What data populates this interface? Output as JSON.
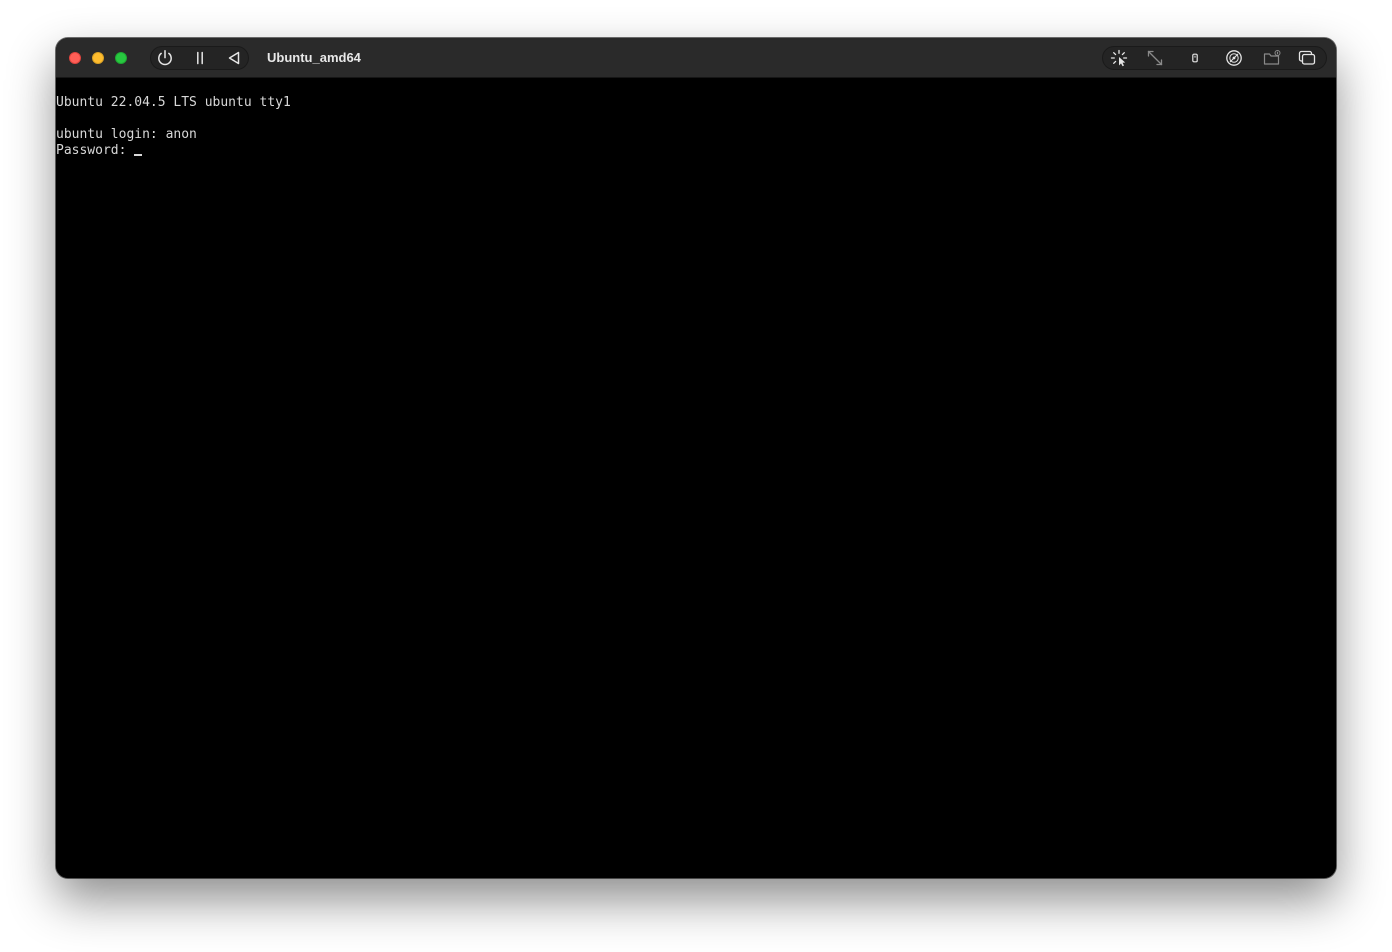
{
  "window": {
    "title": "Ubuntu_amd64"
  },
  "toolbar": {
    "left_icons": [
      "power-icon",
      "pause-icon",
      "back-icon"
    ],
    "right_icons": [
      "capture-input-icon",
      "resize-icon",
      "usb-device-icon",
      "drive-icon",
      "shared-folder-icon",
      "windows-icon"
    ]
  },
  "terminal": {
    "line1": "Ubuntu 22.04.5 LTS ubuntu tty1",
    "line2": "",
    "line3": "ubuntu login: anon",
    "line4": "Password: "
  },
  "colors": {
    "titlebar": "#2a2a2a",
    "screen": "#000000",
    "text": "#d8d8d8",
    "close": "#ff5f57",
    "minimize": "#febc2e",
    "zoom": "#28c840"
  }
}
